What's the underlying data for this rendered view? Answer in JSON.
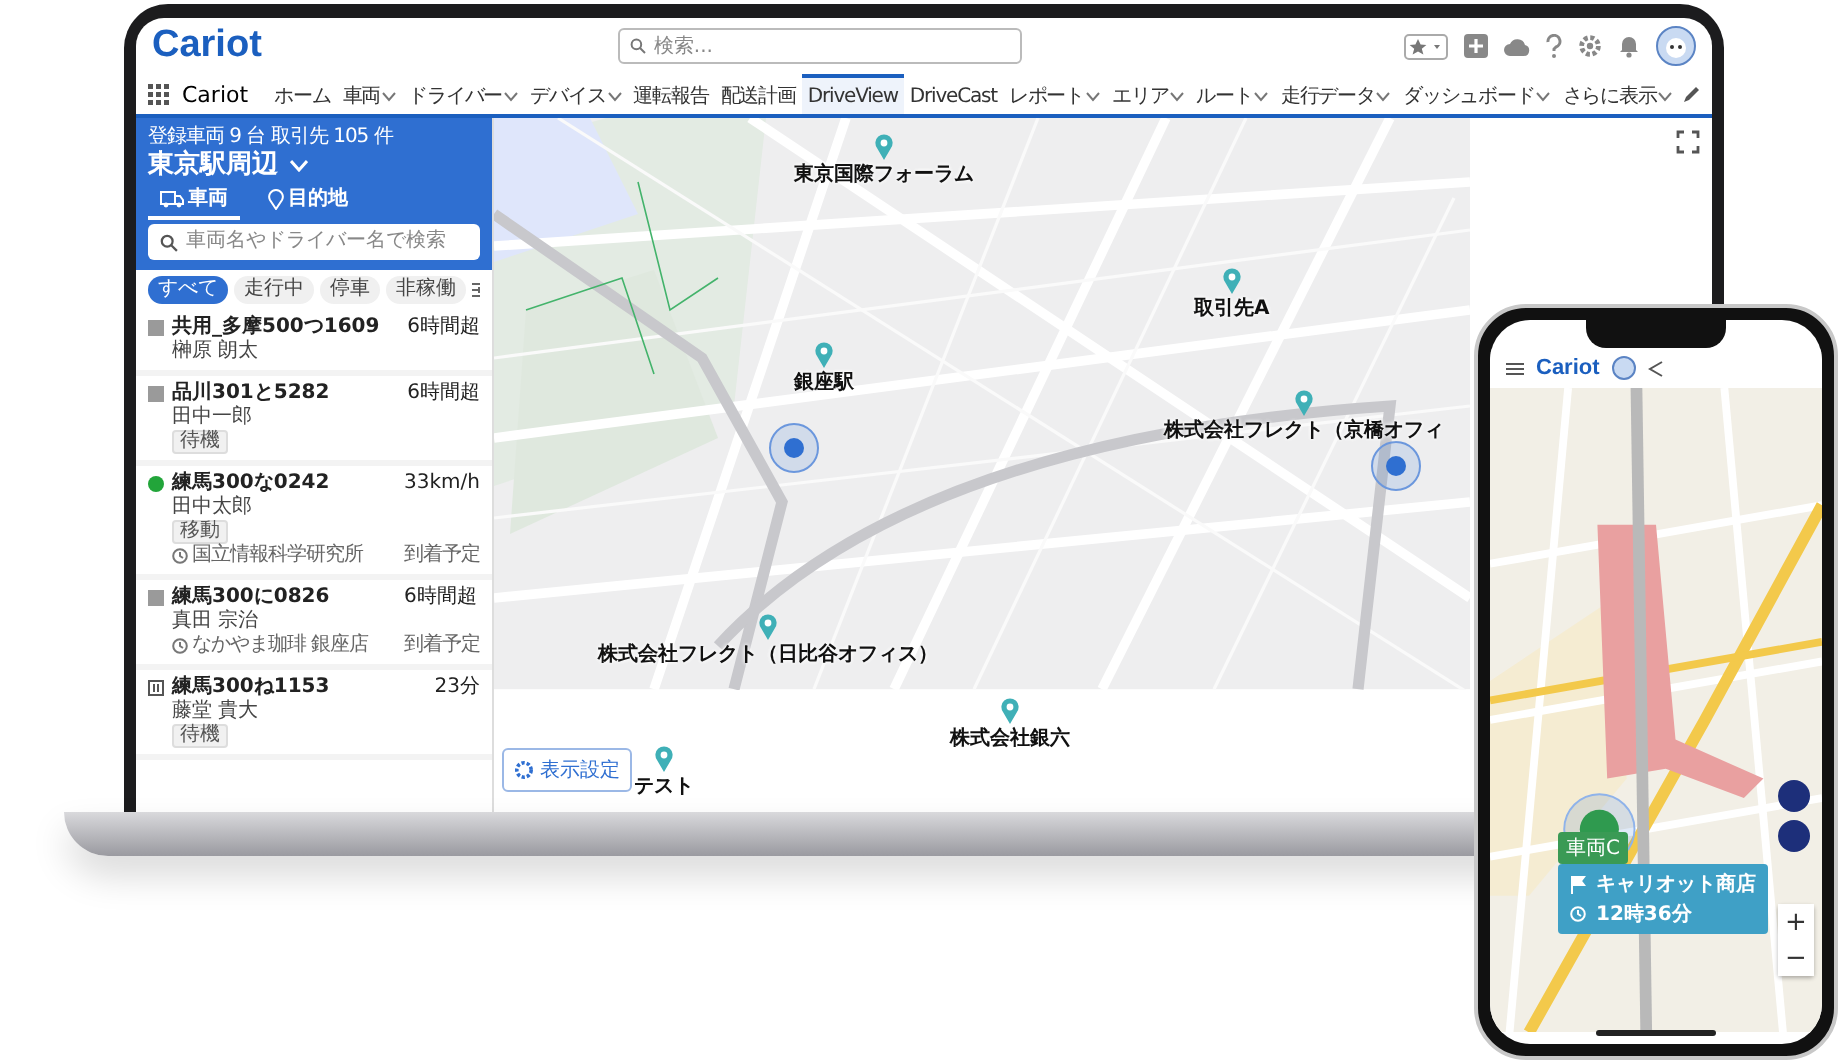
{
  "laptop": {
    "header": {
      "logo": "Cariot",
      "search_placeholder": "検索..."
    },
    "nav": {
      "app_name": "Cariot",
      "items": [
        {
          "label": "ホーム",
          "dropdown": false,
          "selected": false
        },
        {
          "label": "車両",
          "dropdown": true,
          "selected": false
        },
        {
          "label": "ドライバー",
          "dropdown": true,
          "selected": false
        },
        {
          "label": "デバイス",
          "dropdown": true,
          "selected": false
        },
        {
          "label": "運転報告",
          "dropdown": false,
          "selected": false
        },
        {
          "label": "配送計画",
          "dropdown": false,
          "selected": false
        },
        {
          "label": "DriveView",
          "dropdown": false,
          "selected": true
        },
        {
          "label": "DriveCast",
          "dropdown": false,
          "selected": false
        },
        {
          "label": "レポート",
          "dropdown": true,
          "selected": false
        },
        {
          "label": "エリア",
          "dropdown": true,
          "selected": false
        },
        {
          "label": "ルート",
          "dropdown": true,
          "selected": false
        },
        {
          "label": "走行データ",
          "dropdown": true,
          "selected": false
        },
        {
          "label": "ダッシュボード",
          "dropdown": true,
          "selected": false
        },
        {
          "label": "さらに表示",
          "dropdown": true,
          "selected": false
        }
      ]
    },
    "sidebar": {
      "summary": "登録車両 9 台  取引先 105 件",
      "area": "東京駅周辺",
      "tabs": [
        {
          "label": "車両",
          "selected": true
        },
        {
          "label": "目的地",
          "selected": false
        }
      ],
      "search_placeholder": "車両名やドライバー名で検索",
      "filters": [
        {
          "label": "すべて",
          "selected": true
        },
        {
          "label": "走行中",
          "selected": false
        },
        {
          "label": "停車",
          "selected": false
        },
        {
          "label": "非稼働",
          "selected": false
        }
      ],
      "vehicles": [
        {
          "kind": "idle",
          "name": "共用_多摩500つ1609",
          "reading": "6時間超",
          "driver": "榊原 朗太"
        },
        {
          "kind": "idle",
          "name": "品川301と5282",
          "reading": "6時間超",
          "driver": "田中一郎",
          "tag": "待機"
        },
        {
          "kind": "moving",
          "name": "練馬300な0242",
          "reading": "33km/h",
          "driver": "田中太郎",
          "tag": "移動",
          "destination": "国立情報科学研究所",
          "eta": "到着予定"
        },
        {
          "kind": "idle",
          "name": "練馬300に0826",
          "reading": "6時間超",
          "driver": "真田 宗治",
          "destination": "なかやま珈琲 銀座店",
          "eta": "到着予定"
        },
        {
          "kind": "paused",
          "name": "練馬300ね1153",
          "reading": "23分",
          "driver": "藤堂 貴大",
          "tag": "待機"
        }
      ]
    },
    "map": {
      "pins": [
        {
          "label": "東京国際フォーラム"
        },
        {
          "label": "銀座駅"
        },
        {
          "label": "取引先A"
        },
        {
          "label": "株式会社フレクト（京橋オフィ"
        },
        {
          "label": "株式会社フレクト（日比谷オフィス）"
        },
        {
          "label": "株式会社銀六"
        },
        {
          "label": "テスト"
        }
      ],
      "settings_button": "表示設定"
    }
  },
  "phone": {
    "logo": "Cariot",
    "vehicle_tag": "車両C",
    "card": {
      "destination": "キャリオット商店",
      "eta": "12時36分"
    },
    "zoom": [
      "+",
      "−"
    ]
  }
}
